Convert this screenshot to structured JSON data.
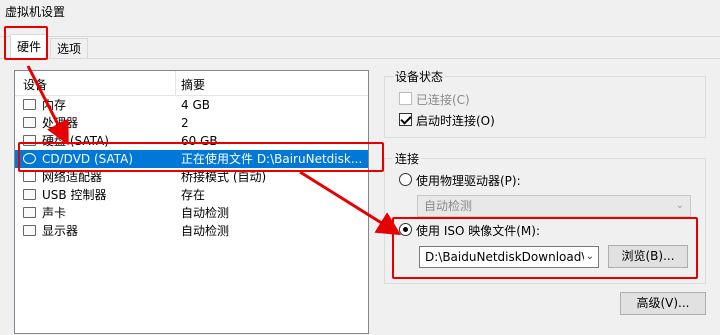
{
  "window": {
    "title": "虚拟机设置"
  },
  "tabs": [
    {
      "label": "硬件"
    },
    {
      "label": "选项"
    }
  ],
  "device_list": {
    "header": {
      "device": "设备",
      "summary": "摘要"
    },
    "rows": [
      {
        "name": "内存",
        "summary": "4 GB"
      },
      {
        "name": "处理器",
        "summary": "2"
      },
      {
        "name": "硬盘 (SATA)",
        "summary": "60 GB"
      },
      {
        "name": "CD/DVD (SATA)",
        "summary": "正在使用文件 D:\\BairuNetdisk..."
      },
      {
        "name": "网络适配器",
        "summary": "桥接模式 (自动)"
      },
      {
        "name": "USB 控制器",
        "summary": "存在"
      },
      {
        "name": "声卡",
        "summary": "自动检测"
      },
      {
        "name": "显示器",
        "summary": "自动检测"
      }
    ]
  },
  "device_status": {
    "title": "设备状态",
    "connected_label": "已连接(C)",
    "connected_checked": false,
    "connect_on_start_label": "启动时连接(O)",
    "connect_on_start_checked": true
  },
  "connection": {
    "title": "连接",
    "physical_drive_label": "使用物理驱动器(P):",
    "physical_drive_value": "自动检测",
    "iso_label": "使用 ISO 映像文件(M):",
    "iso_path": "D:\\BaiduNetdiskDownload\\Ir",
    "browse_label": "浏览(B)...",
    "selected": "iso"
  },
  "advanced_button": {
    "label": "高级(V)..."
  },
  "colors": {
    "accent": "#0078d7",
    "annotation": "#e60000"
  }
}
